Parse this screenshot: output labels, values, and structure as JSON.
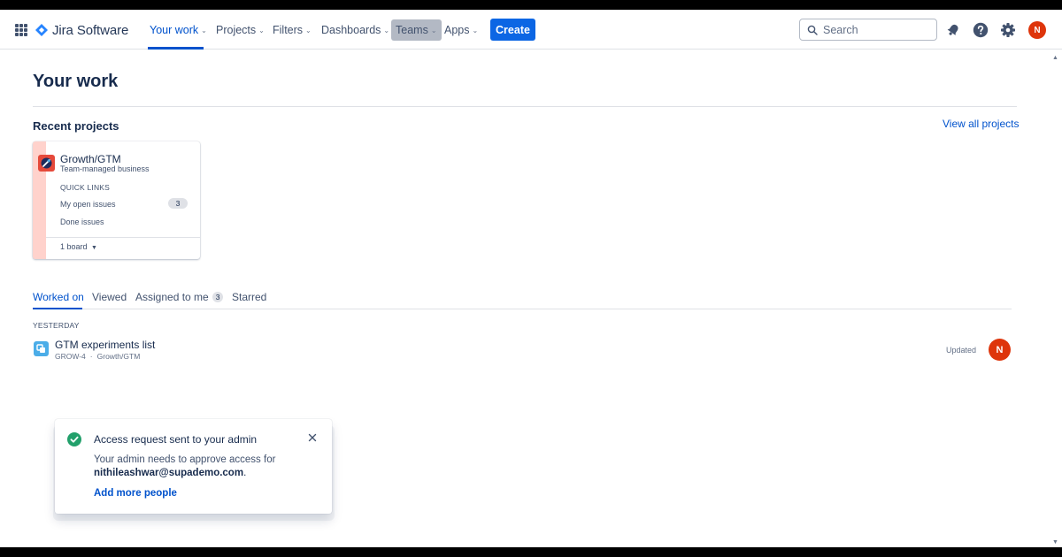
{
  "nav": {
    "app_switcher_icon": "grid-icon",
    "logo_text": "Jira Software",
    "items": [
      {
        "label": "Your work"
      },
      {
        "label": "Projects"
      },
      {
        "label": "Filters"
      },
      {
        "label": "Dashboards"
      },
      {
        "label": "Teams"
      },
      {
        "label": "Apps"
      }
    ],
    "active_item": "Your work",
    "create_label": "Create",
    "search_placeholder": "Search",
    "user_initial": "N"
  },
  "page": {
    "title": "Your work",
    "recent_projects_heading": "Recent projects",
    "view_all_label": "View all projects"
  },
  "project_card": {
    "name": "Growth/GTM",
    "type": "Team-managed business",
    "quick_links_heading": "QUICK LINKS",
    "links": [
      {
        "label": "My open issues",
        "count": "3"
      },
      {
        "label": "Done issues"
      }
    ],
    "boards_label": "1 board"
  },
  "tabs": [
    {
      "label": "Worked on"
    },
    {
      "label": "Viewed"
    },
    {
      "label": "Assigned to me",
      "badge": "3"
    },
    {
      "label": "Starred"
    }
  ],
  "activity": {
    "day_label": "YESTERDAY",
    "items": [
      {
        "title": "GTM experiments list",
        "key": "GROW-4",
        "project": "Growth/GTM",
        "status": "Updated",
        "avatar_initial": "N"
      }
    ]
  },
  "flag": {
    "title": "Access request sent to your admin",
    "body_line1": "Your admin needs to approve access for",
    "email": "nithileashwar@supademo.com",
    "body_suffix": ".",
    "action_label": "Add more people"
  },
  "colors": {
    "brand_blue": "#0052CC",
    "create_button": "#0C66E4",
    "avatar_red": "#DE350B",
    "success_green": "#22A06B",
    "project_stripe": "#FFD2CC"
  }
}
